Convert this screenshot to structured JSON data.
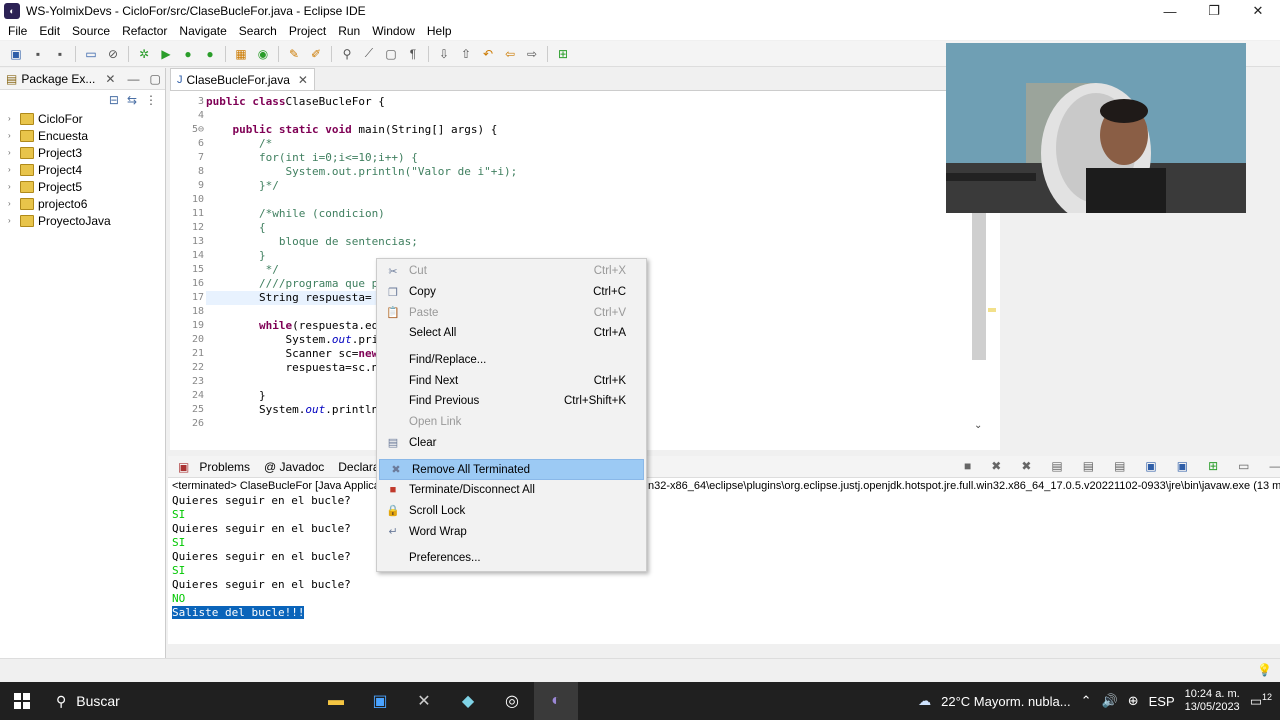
{
  "window": {
    "title": "WS-YolmixDevs - CicloFor/src/ClaseBucleFor.java - Eclipse IDE",
    "minimize": "—",
    "restore": "❐",
    "close": "✕"
  },
  "menu": [
    "File",
    "Edit",
    "Source",
    "Refactor",
    "Navigate",
    "Search",
    "Project",
    "Run",
    "Window",
    "Help"
  ],
  "package_explorer": {
    "tab_label": "Package Ex...",
    "projects": [
      "CicloFor",
      "Encuesta",
      "Project3",
      "Project4",
      "Project5",
      "projecto6",
      "ProyectoJava"
    ]
  },
  "editor": {
    "tab_label": "ClaseBucleFor.java",
    "line_numbers": [
      "3",
      "4",
      "5⊖",
      "6",
      "7",
      "8",
      "9",
      "10",
      "11",
      "12",
      "13",
      "14",
      "15",
      "16",
      "17",
      "18",
      "19",
      "20",
      "21",
      "22",
      "23",
      "24",
      "25",
      "26"
    ],
    "lines": [
      {
        "t": [
          [
            "kw",
            "public class"
          ],
          [
            "",
            "ClaseBucleFor {"
          ]
        ]
      },
      {
        "t": []
      },
      {
        "t": [
          [
            "",
            "    "
          ],
          [
            "kw",
            "public static void"
          ],
          [
            "",
            " main(String[] args) {"
          ]
        ]
      },
      {
        "t": [
          [
            "cm",
            "        /*"
          ]
        ]
      },
      {
        "t": [
          [
            "cm",
            "        for(int i=0;i<=10;i++) {"
          ]
        ]
      },
      {
        "t": [
          [
            "cm",
            "            System.out.println(\"Valor de i\"+i);"
          ]
        ]
      },
      {
        "t": [
          [
            "cm",
            "        }*/"
          ]
        ]
      },
      {
        "t": []
      },
      {
        "t": [
          [
            "cm",
            "        /*while (condicion)"
          ]
        ]
      },
      {
        "t": [
          [
            "cm",
            "        {"
          ]
        ]
      },
      {
        "t": [
          [
            "cm",
            "           bloque de sentencias;"
          ]
        ]
      },
      {
        "t": [
          [
            "cm",
            "        }"
          ]
        ]
      },
      {
        "t": [
          [
            "cm",
            "         */"
          ]
        ]
      },
      {
        "t": [
          [
            "cm",
            "        ////programa que p"
          ]
        ]
      },
      {
        "t": [
          [
            "",
            "        String respuesta="
          ]
        ]
      },
      {
        "t": []
      },
      {
        "t": [
          [
            "",
            "        "
          ],
          [
            "kw",
            "while"
          ],
          [
            "",
            "(respuesta.eq"
          ]
        ]
      },
      {
        "t": [
          [
            "",
            "            System."
          ],
          [
            "fld",
            "out"
          ],
          [
            "",
            ".pri"
          ]
        ]
      },
      {
        "t": [
          [
            "",
            "            Scanner sc="
          ],
          [
            "kw",
            "new"
          ]
        ]
      },
      {
        "t": [
          [
            "",
            "            respuesta=sc.n"
          ]
        ]
      },
      {
        "t": []
      },
      {
        "t": [
          [
            "",
            "        }"
          ]
        ]
      },
      {
        "t": [
          [
            "",
            "        System."
          ],
          [
            "fld",
            "out"
          ],
          [
            "",
            ".println"
          ]
        ]
      },
      {
        "t": []
      }
    ]
  },
  "bottom_panel": {
    "tabs": [
      "Problems",
      "@ Javadoc",
      "Declarati"
    ],
    "console_header": "<terminated> ClaseBucleFor [Java Applica",
    "console_header_right": "n32-x86_64\\eclipse\\plugins\\org.eclipse.justj.openjdk.hotspot.jre.full.win32.x86_64_17.0.5.v20221102-0933\\jre\\bin\\javaw.exe  (13 m",
    "output": [
      {
        "text": "Quieres seguir en el bucle?",
        "kind": "out"
      },
      {
        "text": "SI",
        "kind": "in"
      },
      {
        "text": "Quieres seguir en el bucle?",
        "kind": "out"
      },
      {
        "text": "SI",
        "kind": "in"
      },
      {
        "text": "Quieres seguir en el bucle?",
        "kind": "out"
      },
      {
        "text": "SI",
        "kind": "in"
      },
      {
        "text": "Quieres seguir en el bucle?",
        "kind": "out"
      },
      {
        "text": "NO",
        "kind": "in"
      },
      {
        "text": "Saliste del bucle!!!",
        "kind": "sel"
      }
    ]
  },
  "context_menu": {
    "items": [
      {
        "label": "Cut",
        "shortcut": "Ctrl+X",
        "disabled": true,
        "icon": "cut-icon",
        "glyph": "✂"
      },
      {
        "label": "Copy",
        "shortcut": "Ctrl+C",
        "disabled": false,
        "icon": "copy-icon",
        "glyph": "❐"
      },
      {
        "label": "Paste",
        "shortcut": "Ctrl+V",
        "disabled": true,
        "icon": "paste-icon",
        "glyph": "📋"
      },
      {
        "label": "Select All",
        "shortcut": "Ctrl+A",
        "disabled": false,
        "icon": "",
        "glyph": ""
      },
      {
        "sep": true
      },
      {
        "label": "Find/Replace...",
        "shortcut": "",
        "disabled": false,
        "icon": "",
        "glyph": ""
      },
      {
        "label": "Find Next",
        "shortcut": "Ctrl+K",
        "disabled": false,
        "icon": "",
        "glyph": ""
      },
      {
        "label": "Find Previous",
        "shortcut": "Ctrl+Shift+K",
        "disabled": false,
        "icon": "",
        "glyph": ""
      },
      {
        "label": "Open Link",
        "shortcut": "",
        "disabled": true,
        "icon": "",
        "glyph": ""
      },
      {
        "label": "Clear",
        "shortcut": "",
        "disabled": false,
        "icon": "clear-icon",
        "glyph": "▤"
      },
      {
        "sep": true
      },
      {
        "label": "Remove All Terminated",
        "shortcut": "",
        "disabled": false,
        "icon": "remove-all-terminated-icon",
        "glyph": "✖",
        "highlight": true
      },
      {
        "label": "Terminate/Disconnect All",
        "shortcut": "",
        "disabled": false,
        "icon": "terminate-icon",
        "glyph": "■"
      },
      {
        "label": "Scroll Lock",
        "shortcut": "",
        "disabled": false,
        "icon": "scroll-lock-icon",
        "glyph": "🔒"
      },
      {
        "label": "Word Wrap",
        "shortcut": "",
        "disabled": false,
        "icon": "word-wrap-icon",
        "glyph": "↵"
      },
      {
        "sep": true
      },
      {
        "label": "Preferences...",
        "shortcut": "",
        "disabled": false,
        "icon": "",
        "glyph": ""
      }
    ]
  },
  "taskbar": {
    "search": "Buscar",
    "weather": "22°C  Mayorm. nubla...",
    "lang": "ESP",
    "time": "10:24 a. m.",
    "date": "13/05/2023",
    "notif_count": "12"
  }
}
